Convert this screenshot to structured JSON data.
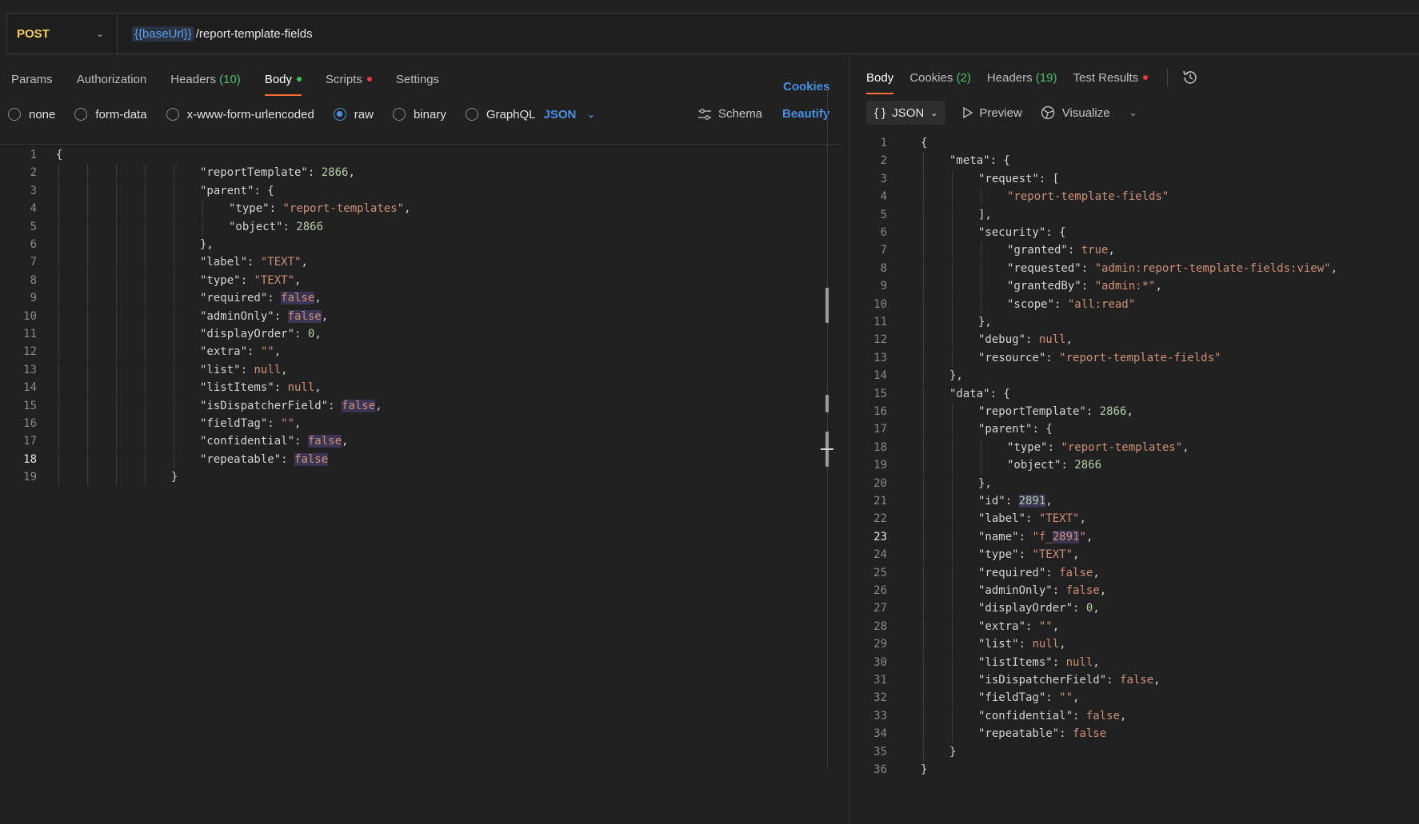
{
  "request": {
    "method": "POST",
    "url_variable": "{{baseUrl}}",
    "url_path": "/report-template-fields"
  },
  "request_tabs": [
    {
      "label": "Params"
    },
    {
      "label": "Authorization"
    },
    {
      "label": "Headers",
      "count": "(10)"
    },
    {
      "label": "Body",
      "active": true,
      "dot": "green"
    },
    {
      "label": "Scripts",
      "dot": "red"
    },
    {
      "label": "Settings"
    }
  ],
  "cookies_label": "Cookies",
  "body_modes": [
    {
      "label": "none"
    },
    {
      "label": "form-data"
    },
    {
      "label": "x-www-form-urlencoded"
    },
    {
      "label": "raw",
      "selected": true
    },
    {
      "label": "binary"
    },
    {
      "label": "GraphQL"
    }
  ],
  "raw_language": "JSON",
  "schema_label": "Schema",
  "beautify_label": "Beautify",
  "request_body_lines": [
    {
      "indent": 0,
      "tokens": [
        [
          "p",
          "{"
        ]
      ]
    },
    {
      "indent": 5,
      "tokens": [
        [
          "k",
          "\"reportTemplate\""
        ],
        [
          "p",
          ": "
        ],
        [
          "n",
          "2866"
        ],
        [
          "p",
          ","
        ]
      ]
    },
    {
      "indent": 5,
      "tokens": [
        [
          "k",
          "\"parent\""
        ],
        [
          "p",
          ": {"
        ]
      ]
    },
    {
      "indent": 6,
      "tokens": [
        [
          "k",
          "\"type\""
        ],
        [
          "p",
          ": "
        ],
        [
          "s",
          "\"report-templates\""
        ],
        [
          "p",
          ","
        ]
      ]
    },
    {
      "indent": 6,
      "tokens": [
        [
          "k",
          "\"object\""
        ],
        [
          "p",
          ": "
        ],
        [
          "n",
          "2866"
        ]
      ]
    },
    {
      "indent": 5,
      "tokens": [
        [
          "p",
          "},"
        ]
      ]
    },
    {
      "indent": 5,
      "tokens": [
        [
          "k",
          "\"label\""
        ],
        [
          "p",
          ": "
        ],
        [
          "s",
          "\"TEXT\""
        ],
        [
          "p",
          ","
        ]
      ]
    },
    {
      "indent": 5,
      "tokens": [
        [
          "k",
          "\"type\""
        ],
        [
          "p",
          ": "
        ],
        [
          "s",
          "\"TEXT\""
        ],
        [
          "p",
          ","
        ]
      ]
    },
    {
      "indent": 5,
      "tokens": [
        [
          "k",
          "\"required\""
        ],
        [
          "p",
          ": "
        ],
        [
          "lh",
          "false"
        ],
        [
          "p",
          ","
        ]
      ]
    },
    {
      "indent": 5,
      "tokens": [
        [
          "k",
          "\"adminOnly\""
        ],
        [
          "p",
          ": "
        ],
        [
          "lh",
          "false"
        ],
        [
          "p",
          ","
        ]
      ]
    },
    {
      "indent": 5,
      "tokens": [
        [
          "k",
          "\"displayOrder\""
        ],
        [
          "p",
          ": "
        ],
        [
          "n",
          "0"
        ],
        [
          "p",
          ","
        ]
      ]
    },
    {
      "indent": 5,
      "tokens": [
        [
          "k",
          "\"extra\""
        ],
        [
          "p",
          ": "
        ],
        [
          "s",
          "\"\""
        ],
        [
          "p",
          ","
        ]
      ]
    },
    {
      "indent": 5,
      "tokens": [
        [
          "k",
          "\"list\""
        ],
        [
          "p",
          ": "
        ],
        [
          "l",
          "null"
        ],
        [
          "p",
          ","
        ]
      ]
    },
    {
      "indent": 5,
      "tokens": [
        [
          "k",
          "\"listItems\""
        ],
        [
          "p",
          ": "
        ],
        [
          "l",
          "null"
        ],
        [
          "p",
          ","
        ]
      ]
    },
    {
      "indent": 5,
      "tokens": [
        [
          "k",
          "\"isDispatcherField\""
        ],
        [
          "p",
          ": "
        ],
        [
          "lh",
          "false"
        ],
        [
          "p",
          ","
        ]
      ]
    },
    {
      "indent": 5,
      "tokens": [
        [
          "k",
          "\"fieldTag\""
        ],
        [
          "p",
          ": "
        ],
        [
          "s",
          "\"\""
        ],
        [
          "p",
          ","
        ]
      ]
    },
    {
      "indent": 5,
      "tokens": [
        [
          "k",
          "\"confidential\""
        ],
        [
          "p",
          ": "
        ],
        [
          "lh",
          "false"
        ],
        [
          "p",
          ","
        ]
      ]
    },
    {
      "indent": 5,
      "tokens": [
        [
          "k",
          "\"repeatable\""
        ],
        [
          "p",
          ": "
        ],
        [
          "lh",
          "false"
        ]
      ],
      "active": true
    },
    {
      "indent": 4,
      "tokens": [
        [
          "p",
          "}"
        ]
      ]
    }
  ],
  "response_tabs": [
    {
      "label": "Body",
      "active": true
    },
    {
      "label": "Cookies",
      "count": "(2)"
    },
    {
      "label": "Headers",
      "count": "(19)"
    },
    {
      "label": "Test Results",
      "dot": "red"
    }
  ],
  "history_icon": "history-icon",
  "response_format": "JSON",
  "preview_label": "Preview",
  "visualize_label": "Visualize",
  "response_body_lines": [
    {
      "indent": 0,
      "tokens": [
        [
          "p",
          "{"
        ]
      ]
    },
    {
      "indent": 1,
      "tokens": [
        [
          "k",
          "\"meta\""
        ],
        [
          "p",
          ": {"
        ]
      ]
    },
    {
      "indent": 2,
      "tokens": [
        [
          "k",
          "\"request\""
        ],
        [
          "p",
          ": ["
        ]
      ]
    },
    {
      "indent": 3,
      "tokens": [
        [
          "s",
          "\"report-template-fields\""
        ]
      ]
    },
    {
      "indent": 2,
      "tokens": [
        [
          "p",
          "],"
        ]
      ]
    },
    {
      "indent": 2,
      "tokens": [
        [
          "k",
          "\"security\""
        ],
        [
          "p",
          ": {"
        ]
      ]
    },
    {
      "indent": 3,
      "tokens": [
        [
          "k",
          "\"granted\""
        ],
        [
          "p",
          ": "
        ],
        [
          "l",
          "true"
        ],
        [
          "p",
          ","
        ]
      ]
    },
    {
      "indent": 3,
      "tokens": [
        [
          "k",
          "\"requested\""
        ],
        [
          "p",
          ": "
        ],
        [
          "s",
          "\"admin:report-template-fields:view\""
        ],
        [
          "p",
          ","
        ]
      ]
    },
    {
      "indent": 3,
      "tokens": [
        [
          "k",
          "\"grantedBy\""
        ],
        [
          "p",
          ": "
        ],
        [
          "s",
          "\"admin:*\""
        ],
        [
          "p",
          ","
        ]
      ]
    },
    {
      "indent": 3,
      "tokens": [
        [
          "k",
          "\"scope\""
        ],
        [
          "p",
          ": "
        ],
        [
          "s",
          "\"all:read\""
        ]
      ]
    },
    {
      "indent": 2,
      "tokens": [
        [
          "p",
          "},"
        ]
      ]
    },
    {
      "indent": 2,
      "tokens": [
        [
          "k",
          "\"debug\""
        ],
        [
          "p",
          ": "
        ],
        [
          "l",
          "null"
        ],
        [
          "p",
          ","
        ]
      ]
    },
    {
      "indent": 2,
      "tokens": [
        [
          "k",
          "\"resource\""
        ],
        [
          "p",
          ": "
        ],
        [
          "s",
          "\"report-template-fields\""
        ]
      ]
    },
    {
      "indent": 1,
      "tokens": [
        [
          "p",
          "},"
        ]
      ]
    },
    {
      "indent": 1,
      "tokens": [
        [
          "k",
          "\"data\""
        ],
        [
          "p",
          ": {"
        ]
      ]
    },
    {
      "indent": 2,
      "tokens": [
        [
          "k",
          "\"reportTemplate\""
        ],
        [
          "p",
          ": "
        ],
        [
          "n",
          "2866"
        ],
        [
          "p",
          ","
        ]
      ]
    },
    {
      "indent": 2,
      "tokens": [
        [
          "k",
          "\"parent\""
        ],
        [
          "p",
          ": {"
        ]
      ]
    },
    {
      "indent": 3,
      "tokens": [
        [
          "k",
          "\"type\""
        ],
        [
          "p",
          ": "
        ],
        [
          "s",
          "\"report-templates\""
        ],
        [
          "p",
          ","
        ]
      ]
    },
    {
      "indent": 3,
      "tokens": [
        [
          "k",
          "\"object\""
        ],
        [
          "p",
          ": "
        ],
        [
          "n",
          "2866"
        ]
      ]
    },
    {
      "indent": 2,
      "tokens": [
        [
          "p",
          "},"
        ]
      ]
    },
    {
      "indent": 2,
      "tokens": [
        [
          "k",
          "\"id\""
        ],
        [
          "p",
          ": "
        ],
        [
          "nh",
          "2891"
        ],
        [
          "p",
          ","
        ]
      ]
    },
    {
      "indent": 2,
      "tokens": [
        [
          "k",
          "\"label\""
        ],
        [
          "p",
          ": "
        ],
        [
          "s",
          "\"TEXT\""
        ],
        [
          "p",
          ","
        ]
      ]
    },
    {
      "indent": 2,
      "tokens": [
        [
          "k",
          "\"name\""
        ],
        [
          "p",
          ": "
        ],
        [
          "s",
          "\"f_"
        ],
        [
          "sh",
          "2891"
        ],
        [
          "s",
          "\""
        ],
        [
          "p",
          ","
        ]
      ],
      "active": true
    },
    {
      "indent": 2,
      "tokens": [
        [
          "k",
          "\"type\""
        ],
        [
          "p",
          ": "
        ],
        [
          "s",
          "\"TEXT\""
        ],
        [
          "p",
          ","
        ]
      ]
    },
    {
      "indent": 2,
      "tokens": [
        [
          "k",
          "\"required\""
        ],
        [
          "p",
          ": "
        ],
        [
          "l",
          "false"
        ],
        [
          "p",
          ","
        ]
      ]
    },
    {
      "indent": 2,
      "tokens": [
        [
          "k",
          "\"adminOnly\""
        ],
        [
          "p",
          ": "
        ],
        [
          "l",
          "false"
        ],
        [
          "p",
          ","
        ]
      ]
    },
    {
      "indent": 2,
      "tokens": [
        [
          "k",
          "\"displayOrder\""
        ],
        [
          "p",
          ": "
        ],
        [
          "n",
          "0"
        ],
        [
          "p",
          ","
        ]
      ]
    },
    {
      "indent": 2,
      "tokens": [
        [
          "k",
          "\"extra\""
        ],
        [
          "p",
          ": "
        ],
        [
          "s",
          "\"\""
        ],
        [
          "p",
          ","
        ]
      ]
    },
    {
      "indent": 2,
      "tokens": [
        [
          "k",
          "\"list\""
        ],
        [
          "p",
          ": "
        ],
        [
          "l",
          "null"
        ],
        [
          "p",
          ","
        ]
      ]
    },
    {
      "indent": 2,
      "tokens": [
        [
          "k",
          "\"listItems\""
        ],
        [
          "p",
          ": "
        ],
        [
          "l",
          "null"
        ],
        [
          "p",
          ","
        ]
      ]
    },
    {
      "indent": 2,
      "tokens": [
        [
          "k",
          "\"isDispatcherField\""
        ],
        [
          "p",
          ": "
        ],
        [
          "l",
          "false"
        ],
        [
          "p",
          ","
        ]
      ]
    },
    {
      "indent": 2,
      "tokens": [
        [
          "k",
          "\"fieldTag\""
        ],
        [
          "p",
          ": "
        ],
        [
          "s",
          "\"\""
        ],
        [
          "p",
          ","
        ]
      ]
    },
    {
      "indent": 2,
      "tokens": [
        [
          "k",
          "\"confidential\""
        ],
        [
          "p",
          ": "
        ],
        [
          "l",
          "false"
        ],
        [
          "p",
          ","
        ]
      ]
    },
    {
      "indent": 2,
      "tokens": [
        [
          "k",
          "\"repeatable\""
        ],
        [
          "p",
          ": "
        ],
        [
          "l",
          "false"
        ]
      ]
    },
    {
      "indent": 1,
      "tokens": [
        [
          "p",
          "}"
        ]
      ]
    },
    {
      "indent": 0,
      "tokens": [
        [
          "p",
          "}"
        ]
      ]
    }
  ],
  "colors": {
    "accent": "#ff6c37",
    "link": "#4a90e2",
    "method_post": "#f2cd60",
    "count_green": "#4fbf6a",
    "dot_red": "#ec3b3b"
  }
}
